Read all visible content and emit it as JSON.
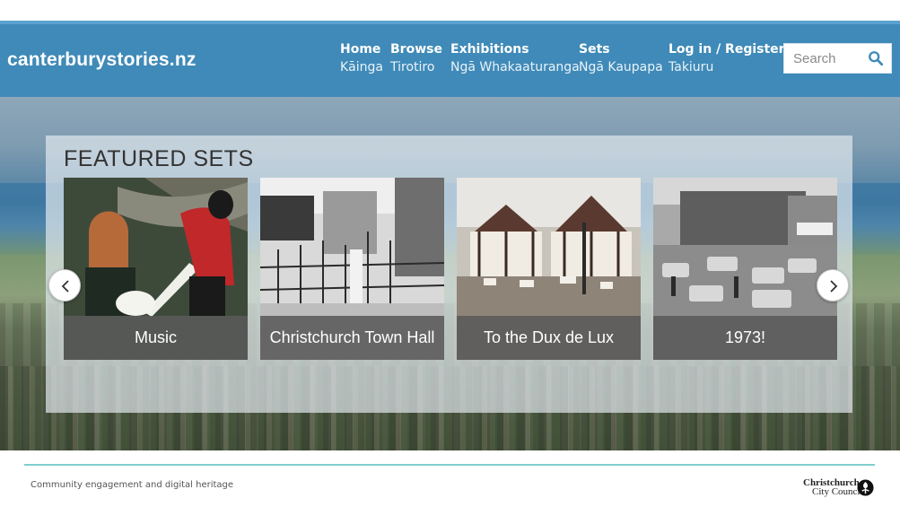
{
  "header": {
    "logo": "canterburystories.nz",
    "nav": [
      {
        "en": "Home",
        "mi": "Kāinga"
      },
      {
        "en": "Browse",
        "mi": "Tirotiro"
      },
      {
        "en": "Exhibitions",
        "mi": "Ngā Whakaaturanga"
      },
      {
        "en": "Sets",
        "mi": "Ngā Kaupapa"
      },
      {
        "en": "Log in / Register",
        "mi": "Takiuru"
      }
    ],
    "search": {
      "placeholder": "Search",
      "icon": "search-icon"
    }
  },
  "featured": {
    "title": "FEATURED SETS",
    "cards": [
      {
        "caption": "Music"
      },
      {
        "caption": "Christchurch Town Hall"
      },
      {
        "caption": "To the Dux de Lux"
      },
      {
        "caption": "1973!"
      }
    ],
    "prev_icon": "chevron-left-icon",
    "next_icon": "chevron-right-icon"
  },
  "footer": {
    "tagline": "Community engagement and digital heritage",
    "council_line1": "Christchurch",
    "council_line2": "City Council"
  },
  "colors": {
    "header_bg": "#3f8ab8",
    "footer_rule": "#7fcfcf",
    "caption_bg": "#5a5a5a"
  }
}
